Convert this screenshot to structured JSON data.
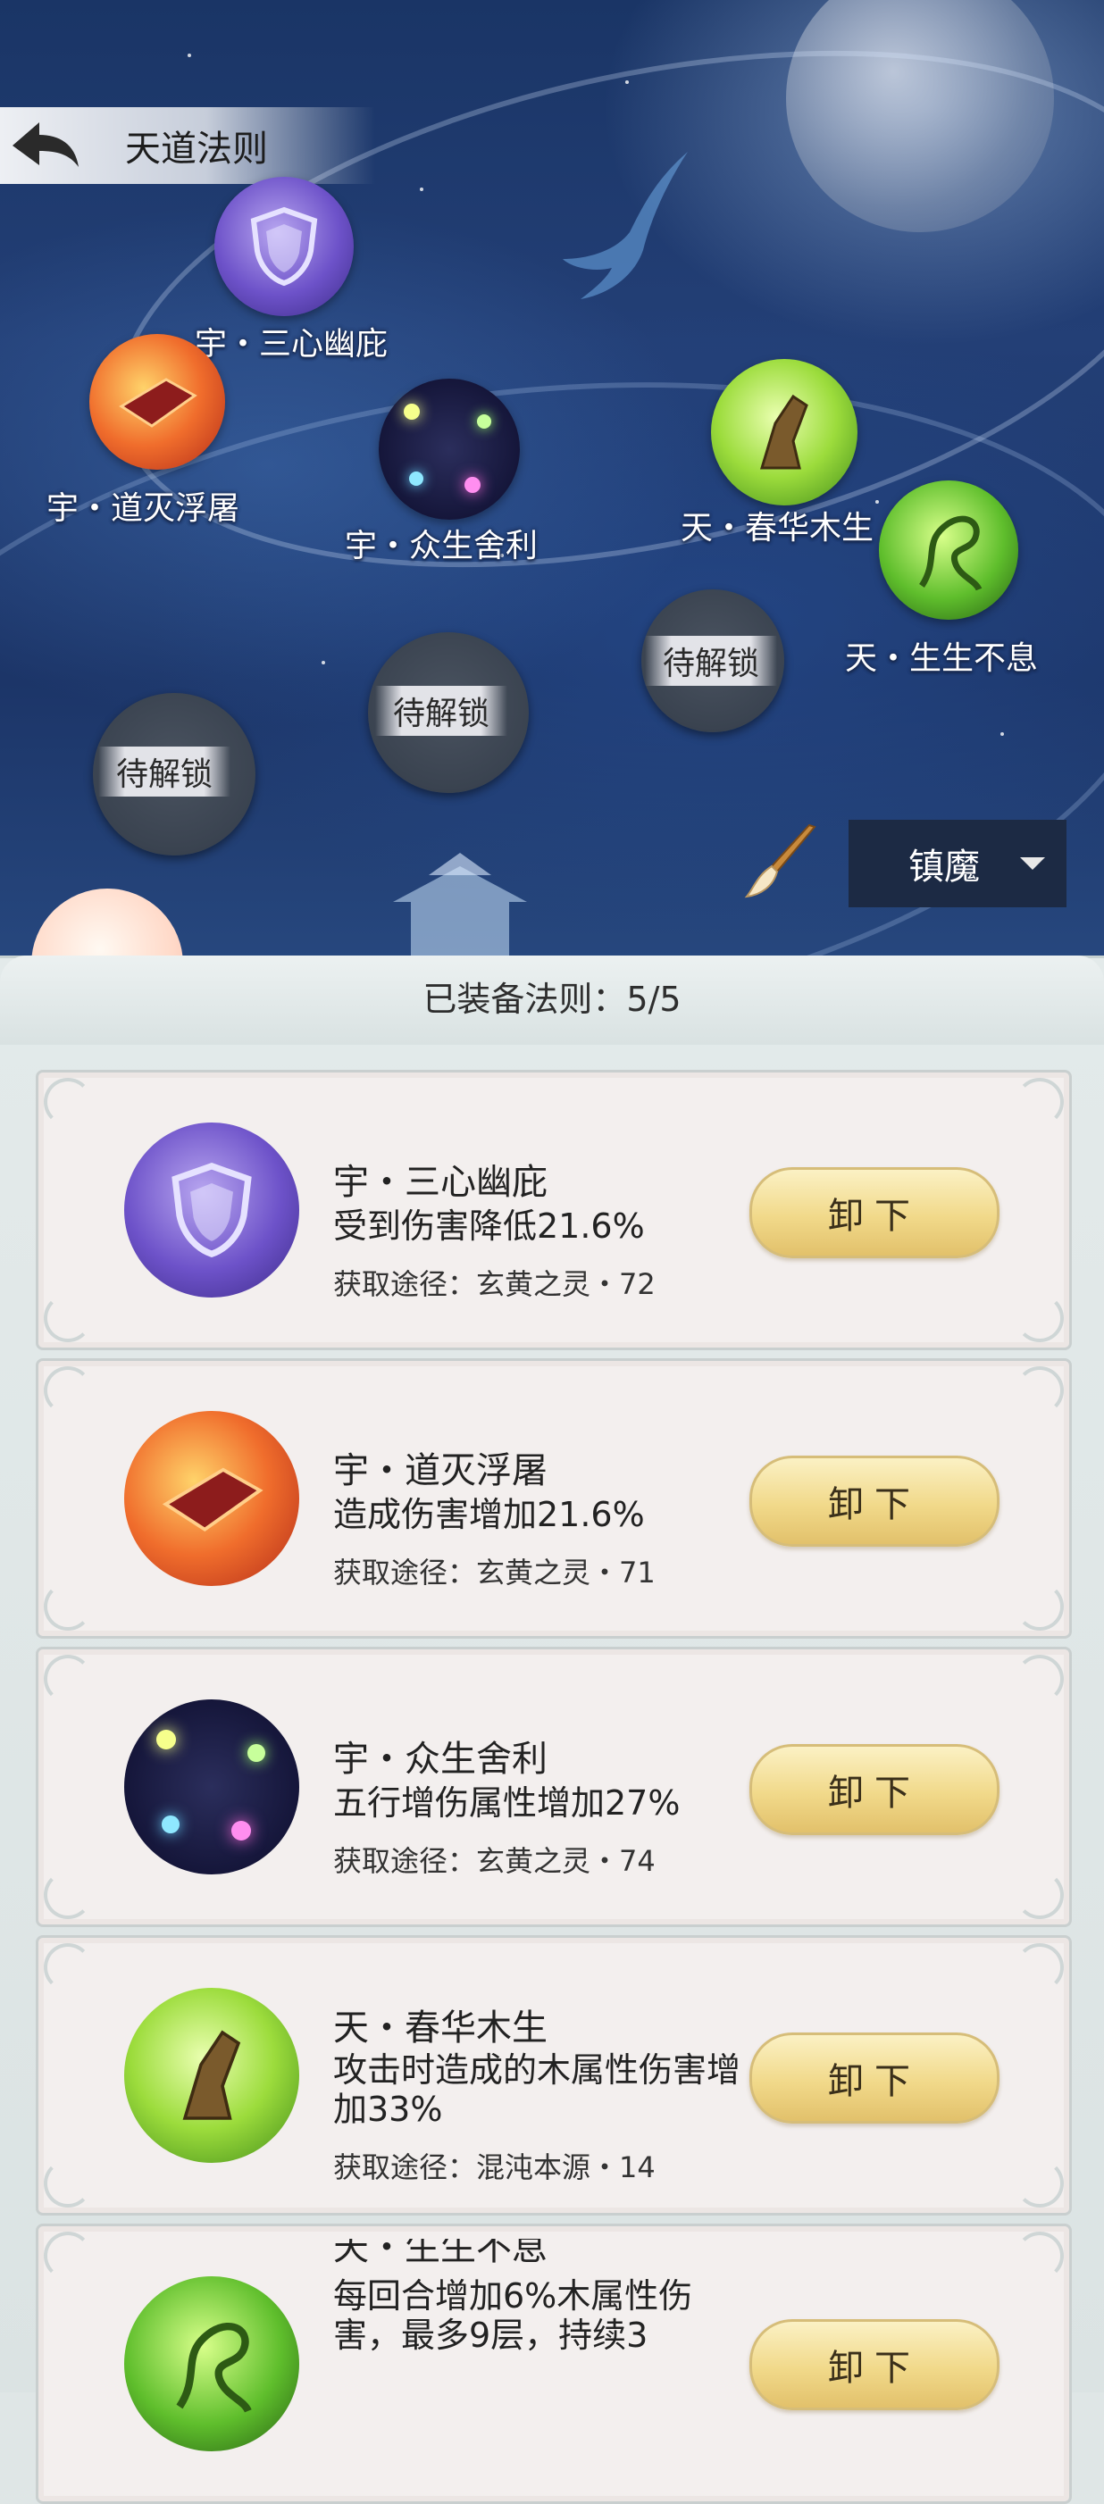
{
  "header": {
    "title": "天道法则"
  },
  "map_nodes": [
    {
      "label": "宇・三心幽庇",
      "icon": "shield-orb-icon"
    },
    {
      "label": "宇・道灭浮屠",
      "icon": "fire-tower-orb-icon"
    },
    {
      "label": "宇・众生舍利",
      "icon": "star-orb-icon"
    },
    {
      "label": "天・春华木生",
      "icon": "wood-orb-icon"
    },
    {
      "label": "天・生生不息",
      "icon": "vine-orb-icon"
    }
  ],
  "locked_nodes": [
    {
      "label": "待解锁"
    },
    {
      "label": "待解锁"
    },
    {
      "label": "待解锁"
    }
  ],
  "filter": {
    "selected": "镇魔"
  },
  "equipped": {
    "label": "已装备法则：5/5"
  },
  "cards": [
    {
      "name": "宇・三心幽庇",
      "effect": "受到伤害降低21.6%",
      "source": "获取途径：玄黄之灵・72",
      "button": "卸下"
    },
    {
      "name": "宇・道灭浮屠",
      "effect": "造成伤害增加21.6%",
      "source": "获取途径：玄黄之灵・71",
      "button": "卸下"
    },
    {
      "name": "宇・众生舍利",
      "effect": "五行增伤属性增加27%",
      "source": "获取途径：玄黄之灵・74",
      "button": "卸下"
    },
    {
      "name": "天・春华木生",
      "effect": "攻击时造成的木属性伤害增加33%",
      "source": "获取途径：混沌本源・14",
      "button": "卸下"
    },
    {
      "name": "天・生生不息",
      "effect": "每回合增加6%木属性伤害，最多9层，持续3",
      "source": "",
      "button": "卸下"
    }
  ],
  "colors": {
    "sky": "#233f76",
    "button_gold": "#f1d98a",
    "card_bg": "#f3efee",
    "dropdown_bg": "#1c2a44"
  }
}
